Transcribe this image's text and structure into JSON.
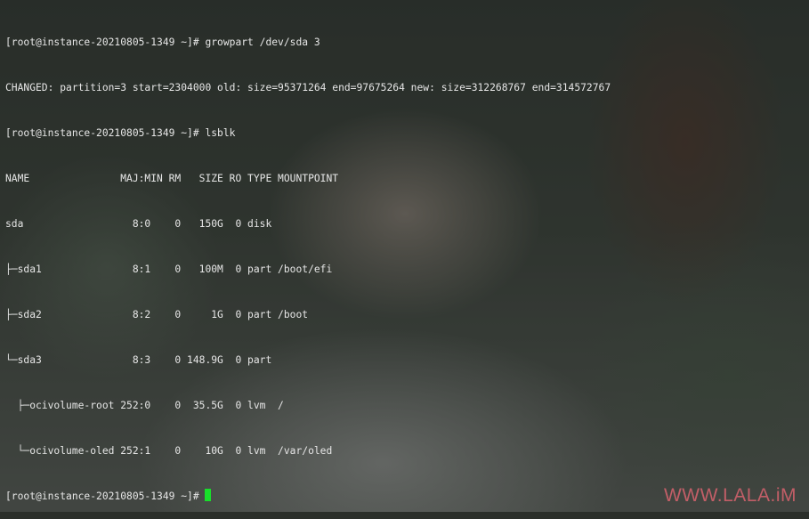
{
  "terminal": {
    "lines": [
      "[root@instance-20210805-1349 ~]# growpart /dev/sda 3",
      "CHANGED: partition=3 start=2304000 old: size=95371264 end=97675264 new: size=312268767 end=314572767",
      "[root@instance-20210805-1349 ~]# lsblk",
      "NAME               MAJ:MIN RM   SIZE RO TYPE MOUNTPOINT",
      "sda                  8:0    0   150G  0 disk",
      "├─sda1               8:1    0   100M  0 part /boot/efi",
      "├─sda2               8:2    0     1G  0 part /boot",
      "└─sda3               8:3    0 148.9G  0 part",
      "  ├─ocivolume-root 252:0    0  35.5G  0 lvm  /",
      "  └─ocivolume-oled 252:1    0    10G  0 lvm  /var/oled"
    ],
    "prompt": "[root@instance-20210805-1349 ~]# ",
    "cursor_color": "#18e02a"
  },
  "watermark": {
    "text": "WWW.LALA.iM",
    "color": "#c9606a"
  }
}
